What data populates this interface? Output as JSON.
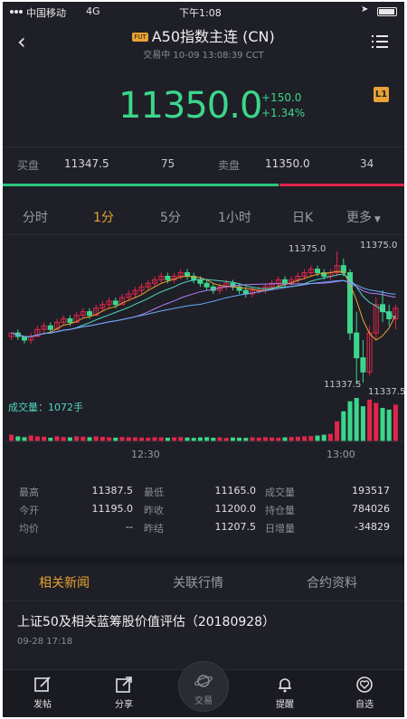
{
  "status_bar": {
    "carrier": "中国移动",
    "network": "4G",
    "time": "下午1:08"
  },
  "header": {
    "badge": "FUT",
    "title": "A50指数主连 (CN)",
    "subtitle": "交易中 10-09 13:08:39 CCT"
  },
  "quote": {
    "price": "11350.0",
    "change": "+150.0",
    "change_pct": "+1.34%",
    "level_badge": "L1",
    "color": "#3cd68b"
  },
  "bid_ask": {
    "bid_label": "买盘",
    "bid_price": "11347.5",
    "bid_volume": "75",
    "ask_label": "卖盘",
    "ask_price": "11350.0",
    "ask_volume": "34",
    "bid_fraction": 0.69
  },
  "periods": [
    {
      "label": "分时",
      "active": false
    },
    {
      "label": "1分",
      "active": true
    },
    {
      "label": "5分",
      "active": false
    },
    {
      "label": "1小时",
      "active": false
    },
    {
      "label": "日K",
      "active": false
    },
    {
      "label": "更多",
      "active": false
    }
  ],
  "chart_labels": {
    "high_marker": "11375.0",
    "axis_max": "11375.0",
    "low_marker": "11337.5",
    "axis_min": "11337.5",
    "volume_label": "成交量：1072手",
    "time_ticks": [
      "12:30",
      "13:00"
    ]
  },
  "chart_data": {
    "type": "candlestick",
    "up_color": "#e0264b",
    "down_color": "#3cd68b",
    "ylim": [
      11337.5,
      11375.0
    ],
    "candles": [
      [
        11351,
        11352,
        11350,
        11352
      ],
      [
        11352,
        11353,
        11350,
        11351
      ],
      [
        11351,
        11351,
        11349,
        11350
      ],
      [
        11350,
        11352,
        11349,
        11351
      ],
      [
        11351,
        11354,
        11351,
        11353
      ],
      [
        11353,
        11355,
        11352,
        11354
      ],
      [
        11354,
        11355,
        11352,
        11353
      ],
      [
        11353,
        11356,
        11353,
        11355
      ],
      [
        11355,
        11357,
        11354,
        11356
      ],
      [
        11356,
        11357,
        11354,
        11355
      ],
      [
        11355,
        11358,
        11355,
        11357
      ],
      [
        11357,
        11359,
        11356,
        11358
      ],
      [
        11358,
        11359,
        11356,
        11357
      ],
      [
        11357,
        11360,
        11357,
        11359
      ],
      [
        11359,
        11361,
        11358,
        11360
      ],
      [
        11360,
        11362,
        11359,
        11361
      ],
      [
        11361,
        11362,
        11359,
        11360
      ],
      [
        11360,
        11363,
        11360,
        11362
      ],
      [
        11362,
        11364,
        11361,
        11363
      ],
      [
        11363,
        11365,
        11362,
        11364
      ],
      [
        11364,
        11366,
        11363,
        11365
      ],
      [
        11365,
        11367,
        11364,
        11366
      ],
      [
        11366,
        11368,
        11365,
        11367
      ],
      [
        11367,
        11369,
        11366,
        11368
      ],
      [
        11368,
        11369,
        11366,
        11367
      ],
      [
        11367,
        11369,
        11366,
        11368
      ],
      [
        11368,
        11370,
        11367,
        11369
      ],
      [
        11369,
        11370,
        11367,
        11368
      ],
      [
        11368,
        11369,
        11366,
        11367
      ],
      [
        11367,
        11368,
        11365,
        11366
      ],
      [
        11366,
        11367,
        11364,
        11365
      ],
      [
        11365,
        11366,
        11363,
        11364
      ],
      [
        11364,
        11366,
        11363,
        11365
      ],
      [
        11365,
        11367,
        11364,
        11366
      ],
      [
        11366,
        11367,
        11364,
        11365
      ],
      [
        11365,
        11366,
        11363,
        11364
      ],
      [
        11364,
        11365,
        11362,
        11363
      ],
      [
        11363,
        11365,
        11362,
        11364
      ],
      [
        11364,
        11365,
        11363,
        11364
      ],
      [
        11364,
        11366,
        11363,
        11365
      ],
      [
        11365,
        11367,
        11364,
        11366
      ],
      [
        11366,
        11368,
        11365,
        11367
      ],
      [
        11367,
        11368,
        11365,
        11366
      ],
      [
        11366,
        11368,
        11365,
        11367
      ],
      [
        11367,
        11369,
        11366,
        11368
      ],
      [
        11368,
        11370,
        11367,
        11369
      ],
      [
        11369,
        11371,
        11368,
        11370
      ],
      [
        11370,
        11371,
        11368,
        11369
      ],
      [
        11369,
        11370,
        11367,
        11368
      ],
      [
        11368,
        11370,
        11367,
        11369
      ],
      [
        11369,
        11375,
        11368,
        11371
      ],
      [
        11371,
        11373,
        11368,
        11369
      ],
      [
        11369,
        11370,
        11350,
        11352
      ],
      [
        11352,
        11358,
        11337.5,
        11345
      ],
      [
        11345,
        11350,
        11338,
        11341
      ],
      [
        11341,
        11354,
        11340,
        11352
      ],
      [
        11352,
        11362,
        11350,
        11360
      ],
      [
        11360,
        11364,
        11355,
        11358
      ],
      [
        11358,
        11360,
        11354,
        11356
      ],
      [
        11356,
        11360,
        11353,
        11359
      ]
    ],
    "volume": [
      40,
      30,
      25,
      35,
      30,
      28,
      22,
      30,
      26,
      24,
      30,
      28,
      25,
      30,
      27,
      24,
      22,
      26,
      25,
      24,
      23,
      22,
      25,
      24,
      22,
      24,
      26,
      23,
      21,
      24,
      25,
      22,
      24,
      20,
      23,
      22,
      21,
      24,
      22,
      25,
      23,
      22,
      24,
      26,
      28,
      30,
      32,
      35,
      40,
      45,
      120,
      180,
      240,
      260,
      210,
      250,
      230,
      200,
      190,
      220
    ]
  },
  "stats": [
    {
      "label": "最高",
      "value": "11387.5"
    },
    {
      "label": "最低",
      "value": "11165.0"
    },
    {
      "label": "成交量",
      "value": "193517"
    },
    {
      "label": "今开",
      "value": "11195.0"
    },
    {
      "label": "昨收",
      "value": "11200.0"
    },
    {
      "label": "持仓量",
      "value": "784026"
    },
    {
      "label": "均价",
      "value": "--"
    },
    {
      "label": "昨结",
      "value": "11207.5"
    },
    {
      "label": "日增量",
      "value": "-34829"
    }
  ],
  "sub_tabs": [
    {
      "label": "相关新闻",
      "active": true
    },
    {
      "label": "关联行情",
      "active": false
    },
    {
      "label": "合约资料",
      "active": false
    }
  ],
  "news": {
    "title": "上证50及相关蓝筹股价值评估（20180928）",
    "time": "09-28 17:18"
  },
  "toolbar": {
    "post": "发帖",
    "share": "分享",
    "trade": "交易",
    "alert": "提醒",
    "watchlist": "自选"
  }
}
